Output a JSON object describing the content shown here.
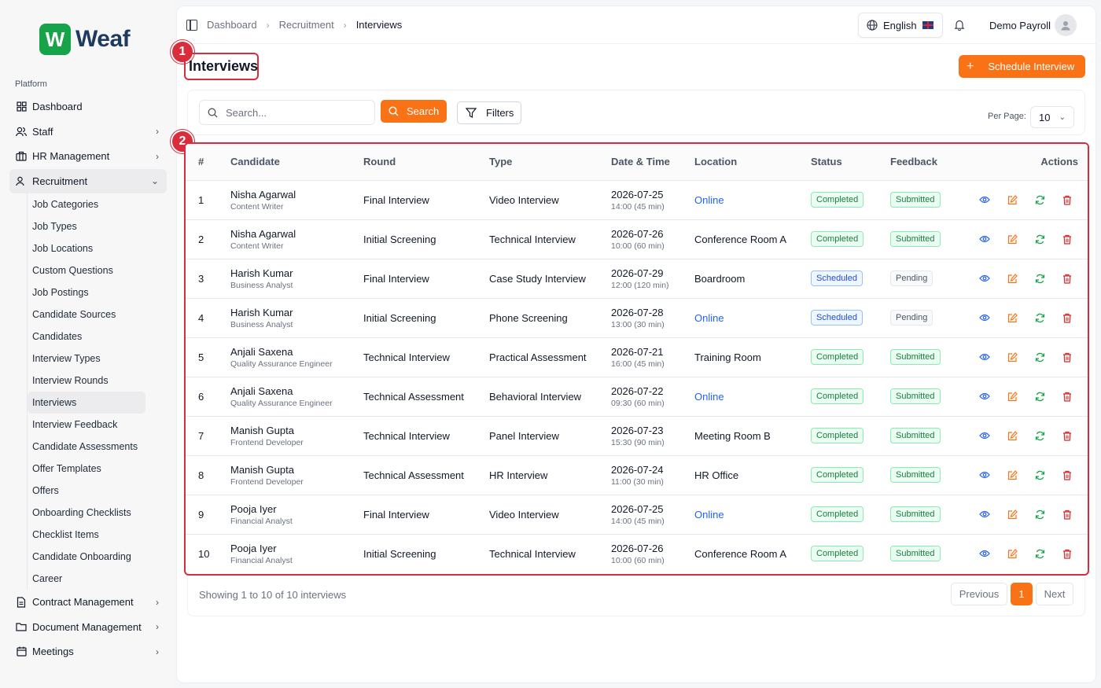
{
  "brand": {
    "logo_mark": "W",
    "name": "Weaf",
    "accent": "#f97316",
    "logo_color": "#16a34a"
  },
  "sidebar": {
    "section_label": "Platform",
    "items": [
      {
        "label": "Dashboard",
        "icon": "grid-icon"
      },
      {
        "label": "Staff",
        "icon": "users-icon"
      },
      {
        "label": "HR Management",
        "icon": "briefcase-icon"
      },
      {
        "label": "Recruitment",
        "icon": "user-plus-icon"
      }
    ],
    "recruitment_sub": [
      "Job Categories",
      "Job Types",
      "Job Locations",
      "Custom Questions",
      "Job Postings",
      "Candidate Sources",
      "Candidates",
      "Interview Types",
      "Interview Rounds",
      "Interviews",
      "Interview Feedback",
      "Candidate Assessments",
      "Offer Templates",
      "Offers",
      "Onboarding Checklists",
      "Checklist Items",
      "Candidate Onboarding",
      "Career"
    ],
    "bottom_items": [
      {
        "label": "Contract Management",
        "icon": "file-icon"
      },
      {
        "label": "Document Management",
        "icon": "folder-icon"
      },
      {
        "label": "Meetings",
        "icon": "calendar-icon"
      }
    ]
  },
  "topbar": {
    "breadcrumb": [
      "Dashboard",
      "Recruitment",
      "Interviews"
    ],
    "language": "English",
    "user_name": "Demo Payroll"
  },
  "page": {
    "title": "Interviews",
    "primary_action": "Schedule Interview",
    "markers": [
      "1",
      "2"
    ]
  },
  "filters": {
    "search_placeholder": "Search...",
    "search_button": "Search",
    "filters_button": "Filters",
    "per_page_label": "Per Page:",
    "per_page_value": "10"
  },
  "table": {
    "columns": [
      "#",
      "Candidate",
      "Round",
      "Type",
      "Date & Time",
      "Location",
      "Status",
      "Feedback",
      "Actions"
    ],
    "rows": [
      {
        "idx": "1",
        "name": "Nisha Agarwal",
        "role": "Content Writer",
        "round": "Final Interview",
        "type": "Video Interview",
        "date": "2026-07-25",
        "time": "14:00 (45 min)",
        "location": "Online",
        "online": true,
        "status": "Completed",
        "feedback": "Submitted"
      },
      {
        "idx": "2",
        "name": "Nisha Agarwal",
        "role": "Content Writer",
        "round": "Initial Screening",
        "type": "Technical Interview",
        "date": "2026-07-26",
        "time": "10:00 (60 min)",
        "location": "Conference Room A",
        "online": false,
        "status": "Completed",
        "feedback": "Submitted"
      },
      {
        "idx": "3",
        "name": "Harish Kumar",
        "role": "Business Analyst",
        "round": "Final Interview",
        "type": "Case Study Interview",
        "date": "2026-07-29",
        "time": "12:00 (120 min)",
        "location": "Boardroom",
        "online": false,
        "status": "Scheduled",
        "feedback": "Pending"
      },
      {
        "idx": "4",
        "name": "Harish Kumar",
        "role": "Business Analyst",
        "round": "Initial Screening",
        "type": "Phone Screening",
        "date": "2026-07-28",
        "time": "13:00 (30 min)",
        "location": "Online",
        "online": true,
        "status": "Scheduled",
        "feedback": "Pending"
      },
      {
        "idx": "5",
        "name": "Anjali Saxena",
        "role": "Quality Assurance Engineer",
        "round": "Technical Interview",
        "type": "Practical Assessment",
        "date": "2026-07-21",
        "time": "16:00 (45 min)",
        "location": "Training Room",
        "online": false,
        "status": "Completed",
        "feedback": "Submitted"
      },
      {
        "idx": "6",
        "name": "Anjali Saxena",
        "role": "Quality Assurance Engineer",
        "round": "Technical Assessment",
        "type": "Behavioral Interview",
        "date": "2026-07-22",
        "time": "09:30 (60 min)",
        "location": "Online",
        "online": true,
        "status": "Completed",
        "feedback": "Submitted"
      },
      {
        "idx": "7",
        "name": "Manish Gupta",
        "role": "Frontend Developer",
        "round": "Technical Interview",
        "type": "Panel Interview",
        "date": "2026-07-23",
        "time": "15:30 (90 min)",
        "location": "Meeting Room B",
        "online": false,
        "status": "Completed",
        "feedback": "Submitted"
      },
      {
        "idx": "8",
        "name": "Manish Gupta",
        "role": "Frontend Developer",
        "round": "Technical Assessment",
        "type": "HR Interview",
        "date": "2026-07-24",
        "time": "11:00 (30 min)",
        "location": "HR Office",
        "online": false,
        "status": "Completed",
        "feedback": "Submitted"
      },
      {
        "idx": "9",
        "name": "Pooja Iyer",
        "role": "Financial Analyst",
        "round": "Final Interview",
        "type": "Video Interview",
        "date": "2026-07-25",
        "time": "14:00 (45 min)",
        "location": "Online",
        "online": true,
        "status": "Completed",
        "feedback": "Submitted"
      },
      {
        "idx": "10",
        "name": "Pooja Iyer",
        "role": "Financial Analyst",
        "round": "Initial Screening",
        "type": "Technical Interview",
        "date": "2026-07-26",
        "time": "10:00 (60 min)",
        "location": "Conference Room A",
        "online": false,
        "status": "Completed",
        "feedback": "Submitted"
      }
    ]
  },
  "pagination": {
    "summary": "Showing 1 to 10 of 10 interviews",
    "previous": "Previous",
    "current": "1",
    "next": "Next"
  }
}
